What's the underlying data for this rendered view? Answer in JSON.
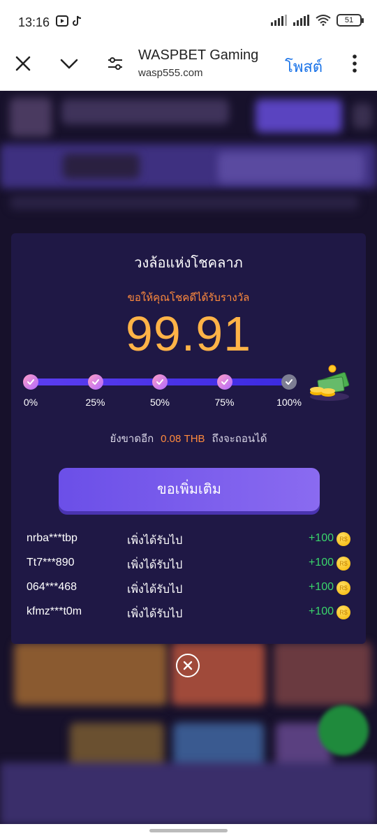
{
  "status_bar": {
    "time": "13:16",
    "battery": "51"
  },
  "browser": {
    "title": "WASPBET Gaming",
    "url": "wasp555.com",
    "post_label": "โพสต์"
  },
  "modal": {
    "title": "วงล้อแห่งโชคลาภ",
    "subtitle": "ขอให้คุณโชคดีได้รับรางวัล",
    "amount": "99.91",
    "progress": {
      "value_percent": 99.91,
      "milestones": [
        {
          "label": "0%",
          "reached": true
        },
        {
          "label": "25%",
          "reached": true
        },
        {
          "label": "50%",
          "reached": true
        },
        {
          "label": "75%",
          "reached": true
        },
        {
          "label": "100%",
          "reached": false
        }
      ]
    },
    "remaining": {
      "prefix": "ยังขาดอีก",
      "amount": "0.08 THB",
      "suffix": "ถึงจะถอนได้"
    },
    "claim_button": "ขอเพิ่มเติม",
    "winners": [
      {
        "name": "nrba***tbp",
        "text": "เพิ่งได้รับไป",
        "amount": "+100"
      },
      {
        "name": "Tt7***890",
        "text": "เพิ่งได้รับไป",
        "amount": "+100"
      },
      {
        "name": "064***468",
        "text": "เพิ่งได้รับไป",
        "amount": "+100"
      },
      {
        "name": "kfmz***t0m",
        "text": "เพิ่งได้รับไป",
        "amount": "+100"
      }
    ],
    "coin_icon": "coin-icon"
  },
  "colors": {
    "accent_orange": "#ff8a3d",
    "amount_gold": "#ffb347",
    "button_purple": "#7b5cf0",
    "win_green": "#3ad56b",
    "modal_bg": "#1f1845"
  }
}
